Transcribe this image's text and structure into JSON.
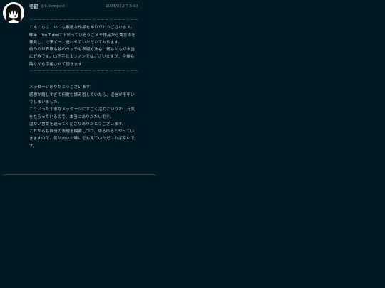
{
  "post": {
    "author": {
      "display_name": "冬凪",
      "handle": "@k_tempest",
      "avatar_icon": "avatar-icon"
    },
    "timestamp": "2024/01/07 5:43",
    "message_lines": [
      "－－－－－－－－－－－－－－－－－－－－－－－－－－",
      "こんにちは、いつも素敵な作品をありがとうございます。",
      "昨年、YouTubeに上がっているうごメモ作品から貴方様を",
      "発見し、以来ずっと追わせていただいております。",
      "前作の世界観も絵のタッチも表現方法も、何もかもが本当",
      "に好みです。ロ下手な１ファンではございますが、今後も",
      "陰ながら応援させて頂きます！",
      "－－－－－－－－－－－－－－－－－－－－－－－－－－"
    ],
    "reply_lines": [
      "メッセージありがとうございます！",
      "感想が嬉しすぎて何度も読み返していたら、返信が半年い",
      "でしまいました。",
      "こういった丁寧なメッセージにすごく活力というか...元気",
      "をもらっているので、本当にありがたいです。",
      "温かい言葉を送ってくださりありがとうございます。",
      "これからも自分の表現を模索しつつ、ゆるゆるとやってい",
      "きますので、気が向いた時にでも見ていただければ幸いで",
      "す。"
    ]
  },
  "colors": {
    "background": "#021823",
    "text": "#c4ccd2",
    "muted": "#7c8a93"
  }
}
